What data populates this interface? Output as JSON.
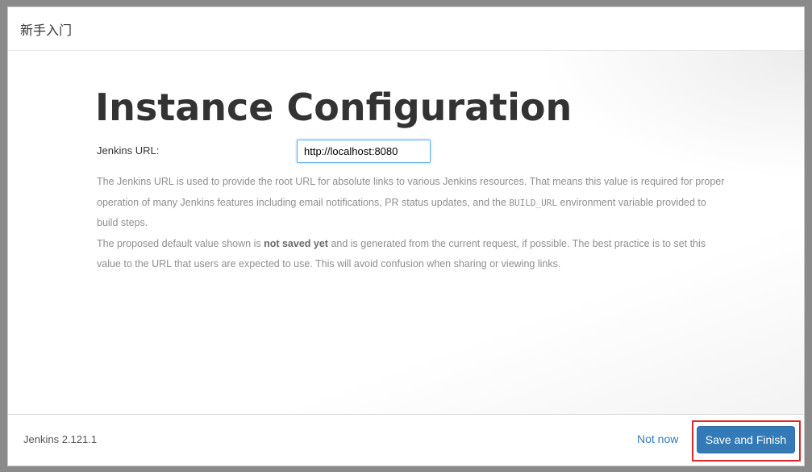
{
  "dialog": {
    "title": "新手入门"
  },
  "main": {
    "heading": "Instance Configuration",
    "url_label": "Jenkins URL:",
    "url_value": "http://localhost:8080",
    "help": {
      "p1_part1": "The Jenkins URL is used to provide the root URL for absolute links to various Jenkins resources. That means this value is required for proper operation of many Jenkins features including email notifications, PR status updates, and the ",
      "p1_code": "BUILD_URL",
      "p1_part2": " environment variable provided to build steps.",
      "p2_part1": "The proposed default value shown is ",
      "p2_bold": "not saved yet",
      "p2_part2": " and is generated from the current request, if possible. The best practice is to set this value to the URL that users are expected to use. This will avoid confusion when sharing or viewing links."
    }
  },
  "footer": {
    "version": "Jenkins 2.121.1",
    "not_now_label": "Not now",
    "save_label": "Save and Finish"
  },
  "colors": {
    "primary_button": "#337ab7",
    "link": "#337ab7",
    "highlight_box": "#e0262b",
    "help_text": "#8f8f8f"
  }
}
